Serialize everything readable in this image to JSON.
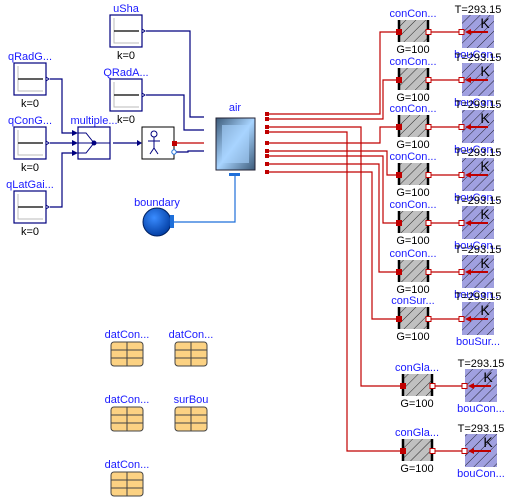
{
  "colors": {
    "heat": "#c00000",
    "signal": "#00007f",
    "fluid": "#1e6fd9",
    "label": "#1a1aff"
  },
  "sources": [
    {
      "name": "uSha",
      "param": "k=0"
    },
    {
      "name": "QRadA...",
      "param": "k=0"
    },
    {
      "name": "qRadG...",
      "param": "k=0"
    },
    {
      "name": "qConG...",
      "param": "k=0"
    },
    {
      "name": "qLatGai...",
      "param": "k=0"
    }
  ],
  "multiplex": {
    "name": "multiple..."
  },
  "room": {
    "name": "air"
  },
  "boundary": {
    "name": "boundary"
  },
  "records": [
    {
      "name": "datCon..."
    },
    {
      "name": "datCon..."
    },
    {
      "name": "datCon..."
    },
    {
      "name": "surBou"
    },
    {
      "name": "datCon..."
    }
  ],
  "conductors": [
    {
      "name": "conCon...",
      "param": "G=100",
      "bou": "bouCon...",
      "T": "T=293.15"
    },
    {
      "name": "conCon...",
      "param": "G=100",
      "bou": "bouCon...",
      "T": "T=293.15"
    },
    {
      "name": "conCon...",
      "param": "G=100",
      "bou": "bouCon...",
      "T": "T=293.15"
    },
    {
      "name": "conCon...",
      "param": "G=100",
      "bou": "bouCon...",
      "T": "T=293.15"
    },
    {
      "name": "conCon...",
      "param": "G=100",
      "bou": "bouCon...",
      "T": "T=293.15"
    },
    {
      "name": "conCon...",
      "param": "G=100",
      "bou": "bouCon...",
      "T": "T=293.15"
    },
    {
      "name": "conSur...",
      "param": "G=100",
      "bou": "bouSur...",
      "T": "T=293.15"
    },
    {
      "name": "conGla...",
      "param": "G=100",
      "bou": "bouCon...",
      "T": "T=293.15"
    },
    {
      "name": "conGla...",
      "param": "G=100",
      "bou": "bouCon...",
      "T": "T=293.15"
    }
  ]
}
